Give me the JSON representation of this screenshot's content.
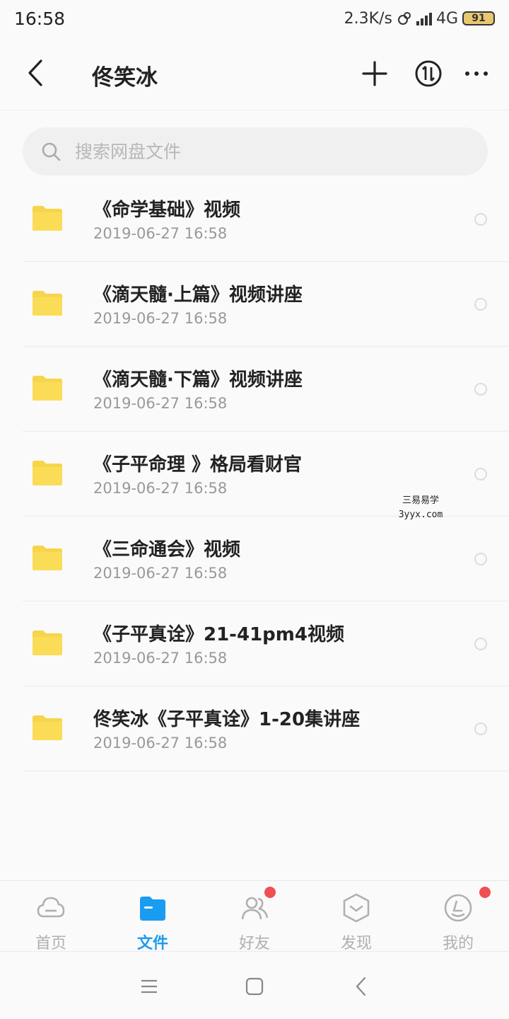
{
  "status_bar": {
    "time": "16:58",
    "speed": "2.3K/s",
    "network": "4G",
    "battery": "91"
  },
  "header": {
    "title": "佟笑冰",
    "icons": [
      "back-arrow-icon",
      "plus-icon",
      "transfer-icon",
      "more-icon"
    ]
  },
  "search": {
    "placeholder": "搜索网盘文件"
  },
  "files": [
    {
      "name": "《命学基础》视频",
      "date": "2019-06-27  16:58"
    },
    {
      "name": "《滴天髓·上篇》视频讲座",
      "date": "2019-06-27  16:58"
    },
    {
      "name": "《滴天髓·下篇》视频讲座",
      "date": "2019-06-27  16:58"
    },
    {
      "name": "《子平命理 》格局看财官",
      "date": "2019-06-27  16:58"
    },
    {
      "name": "《三命通会》视频",
      "date": "2019-06-27  16:58"
    },
    {
      "name": "《子平真诠》21-41pm4视频",
      "date": "2019-06-27  16:58"
    },
    {
      "name": "佟笑冰《子平真诠》1-20集讲座",
      "date": "2019-06-27  16:58"
    }
  ],
  "watermark": {
    "line1": "三易易学",
    "line2": "3yyx.com"
  },
  "bottom_nav": [
    {
      "label": "首页",
      "icon": "cloud-icon",
      "active": false,
      "badge": false
    },
    {
      "label": "文件",
      "icon": "folder-icon",
      "active": true,
      "badge": false
    },
    {
      "label": "好友",
      "icon": "friends-icon",
      "active": false,
      "badge": true
    },
    {
      "label": "发现",
      "icon": "discover-icon",
      "active": false,
      "badge": false
    },
    {
      "label": "我的",
      "icon": "profile-icon",
      "active": false,
      "badge": true
    }
  ],
  "colors": {
    "accent": "#1a9cf0",
    "folder": "#f7d54a",
    "badge": "#ef4f52"
  }
}
